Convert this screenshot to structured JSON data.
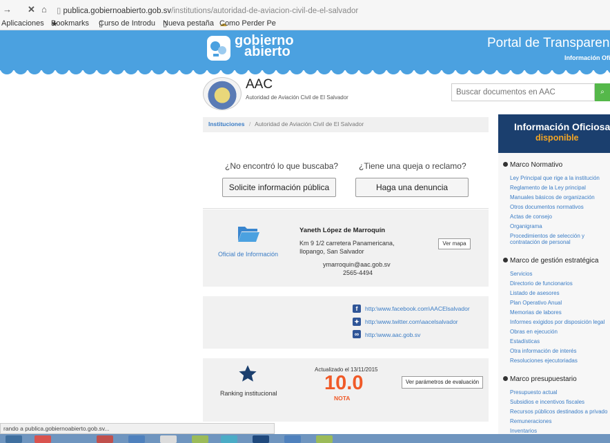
{
  "browser": {
    "url_host": "publica.gobiernoabierto.gob.sv",
    "url_path": "/institutions/autoridad-de-aviacion-civil-de-el-salvador",
    "bookmarks": [
      "Aplicaciones",
      "Bookmarks",
      "Curso de Introdu",
      "Nueva pestaña",
      "Como Perder Pe"
    ],
    "status": "rando a publica.gobiernoabierto.gob.sv..."
  },
  "header": {
    "logo_line1": "gobierno",
    "logo_line2": "abierto",
    "portal_title": "Portal de Transparenci",
    "portal_sub": "Información Ofici"
  },
  "institution": {
    "abbr": "AAC",
    "name": "Autoridad de Aviación Civil de El Salvador",
    "search_placeholder": "Buscar documentos en AAC"
  },
  "breadcrumb": {
    "root": "Instituciones",
    "sep": "/",
    "current": "Autoridad de Aviación Civil de El Salvador"
  },
  "help": {
    "q1": "¿No encontró lo que buscaba?",
    "q2": "¿Tiene una queja o reclamo?",
    "btn1": "Solicite información pública",
    "btn2": "Haga una denuncia"
  },
  "officer": {
    "label": "Oficial de Información",
    "name": "Yaneth López de Marroquín",
    "address1": "Km 9 1/2 carretera Panamericana,",
    "address2": "Ilopango, San Salvador",
    "email": "ymarroquin@aac.gob.sv",
    "phone": "2565-4494",
    "map_btn": "Ver mapa"
  },
  "social": {
    "facebook": "http:\\www.facebook.com\\AACElsalvador",
    "twitter": "http:\\www.twitter.com\\aacelsalvador",
    "web": "http:\\www.aac.gob.sv"
  },
  "ranking": {
    "label": "Ranking institucional",
    "updated": "Actualizado el 13/11/2015",
    "score": "10.0",
    "score_label": "NOTA",
    "eval_btn": "Ver parámetros de evaluación"
  },
  "sidebar": {
    "title": "Información Oficiosa",
    "subtitle": "disponible",
    "sections": [
      {
        "heading": "Marco Normativo",
        "links": [
          "Ley Principal que rige a la institución",
          "Reglamento de la Ley principal",
          "Manuales básicos de organización",
          "Otros documentos normativos",
          "Actas de consejo",
          "Organigrama",
          "Procedimientos de selección y",
          "contratación de personal"
        ]
      },
      {
        "heading": "Marco de gestión estratégica",
        "links": [
          "Servicios",
          "Directorio de funcionarios",
          "Listado de asesores",
          "Plan Operativo Anual",
          "Memorias de labores",
          "Informes exigidos por disposición legal",
          "Obras en ejecución",
          "Estadísticas",
          "Otra información de interés",
          "Resoluciones ejecutoriadas"
        ]
      },
      {
        "heading": "Marco presupuestario",
        "links": [
          "Presupuesto actual",
          "Subsidios e incentivos fiscales",
          "Recursos públicos destinados a privado",
          "Remuneraciones",
          "Inventarios"
        ]
      }
    ]
  },
  "colors": {
    "header_blue": "#4ba1e0",
    "sidebar_navy": "#1b3f6e",
    "accent_orange": "#f05a28",
    "link_blue": "#3a7cc5"
  }
}
